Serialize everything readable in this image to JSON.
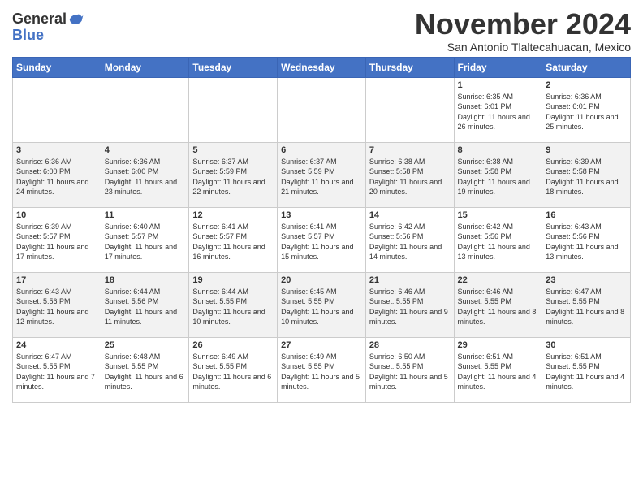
{
  "header": {
    "logo_general": "General",
    "logo_blue": "Blue",
    "month_title": "November 2024",
    "subtitle": "San Antonio Tlaltecahuacan, Mexico"
  },
  "days_of_week": [
    "Sunday",
    "Monday",
    "Tuesday",
    "Wednesday",
    "Thursday",
    "Friday",
    "Saturday"
  ],
  "weeks": [
    [
      {
        "day": "",
        "info": ""
      },
      {
        "day": "",
        "info": ""
      },
      {
        "day": "",
        "info": ""
      },
      {
        "day": "",
        "info": ""
      },
      {
        "day": "",
        "info": ""
      },
      {
        "day": "1",
        "info": "Sunrise: 6:35 AM\nSunset: 6:01 PM\nDaylight: 11 hours and 26 minutes."
      },
      {
        "day": "2",
        "info": "Sunrise: 6:36 AM\nSunset: 6:01 PM\nDaylight: 11 hours and 25 minutes."
      }
    ],
    [
      {
        "day": "3",
        "info": "Sunrise: 6:36 AM\nSunset: 6:00 PM\nDaylight: 11 hours and 24 minutes."
      },
      {
        "day": "4",
        "info": "Sunrise: 6:36 AM\nSunset: 6:00 PM\nDaylight: 11 hours and 23 minutes."
      },
      {
        "day": "5",
        "info": "Sunrise: 6:37 AM\nSunset: 5:59 PM\nDaylight: 11 hours and 22 minutes."
      },
      {
        "day": "6",
        "info": "Sunrise: 6:37 AM\nSunset: 5:59 PM\nDaylight: 11 hours and 21 minutes."
      },
      {
        "day": "7",
        "info": "Sunrise: 6:38 AM\nSunset: 5:58 PM\nDaylight: 11 hours and 20 minutes."
      },
      {
        "day": "8",
        "info": "Sunrise: 6:38 AM\nSunset: 5:58 PM\nDaylight: 11 hours and 19 minutes."
      },
      {
        "day": "9",
        "info": "Sunrise: 6:39 AM\nSunset: 5:58 PM\nDaylight: 11 hours and 18 minutes."
      }
    ],
    [
      {
        "day": "10",
        "info": "Sunrise: 6:39 AM\nSunset: 5:57 PM\nDaylight: 11 hours and 17 minutes."
      },
      {
        "day": "11",
        "info": "Sunrise: 6:40 AM\nSunset: 5:57 PM\nDaylight: 11 hours and 17 minutes."
      },
      {
        "day": "12",
        "info": "Sunrise: 6:41 AM\nSunset: 5:57 PM\nDaylight: 11 hours and 16 minutes."
      },
      {
        "day": "13",
        "info": "Sunrise: 6:41 AM\nSunset: 5:57 PM\nDaylight: 11 hours and 15 minutes."
      },
      {
        "day": "14",
        "info": "Sunrise: 6:42 AM\nSunset: 5:56 PM\nDaylight: 11 hours and 14 minutes."
      },
      {
        "day": "15",
        "info": "Sunrise: 6:42 AM\nSunset: 5:56 PM\nDaylight: 11 hours and 13 minutes."
      },
      {
        "day": "16",
        "info": "Sunrise: 6:43 AM\nSunset: 5:56 PM\nDaylight: 11 hours and 13 minutes."
      }
    ],
    [
      {
        "day": "17",
        "info": "Sunrise: 6:43 AM\nSunset: 5:56 PM\nDaylight: 11 hours and 12 minutes."
      },
      {
        "day": "18",
        "info": "Sunrise: 6:44 AM\nSunset: 5:56 PM\nDaylight: 11 hours and 11 minutes."
      },
      {
        "day": "19",
        "info": "Sunrise: 6:44 AM\nSunset: 5:55 PM\nDaylight: 11 hours and 10 minutes."
      },
      {
        "day": "20",
        "info": "Sunrise: 6:45 AM\nSunset: 5:55 PM\nDaylight: 11 hours and 10 minutes."
      },
      {
        "day": "21",
        "info": "Sunrise: 6:46 AM\nSunset: 5:55 PM\nDaylight: 11 hours and 9 minutes."
      },
      {
        "day": "22",
        "info": "Sunrise: 6:46 AM\nSunset: 5:55 PM\nDaylight: 11 hours and 8 minutes."
      },
      {
        "day": "23",
        "info": "Sunrise: 6:47 AM\nSunset: 5:55 PM\nDaylight: 11 hours and 8 minutes."
      }
    ],
    [
      {
        "day": "24",
        "info": "Sunrise: 6:47 AM\nSunset: 5:55 PM\nDaylight: 11 hours and 7 minutes."
      },
      {
        "day": "25",
        "info": "Sunrise: 6:48 AM\nSunset: 5:55 PM\nDaylight: 11 hours and 6 minutes."
      },
      {
        "day": "26",
        "info": "Sunrise: 6:49 AM\nSunset: 5:55 PM\nDaylight: 11 hours and 6 minutes."
      },
      {
        "day": "27",
        "info": "Sunrise: 6:49 AM\nSunset: 5:55 PM\nDaylight: 11 hours and 5 minutes."
      },
      {
        "day": "28",
        "info": "Sunrise: 6:50 AM\nSunset: 5:55 PM\nDaylight: 11 hours and 5 minutes."
      },
      {
        "day": "29",
        "info": "Sunrise: 6:51 AM\nSunset: 5:55 PM\nDaylight: 11 hours and 4 minutes."
      },
      {
        "day": "30",
        "info": "Sunrise: 6:51 AM\nSunset: 5:55 PM\nDaylight: 11 hours and 4 minutes."
      }
    ]
  ]
}
